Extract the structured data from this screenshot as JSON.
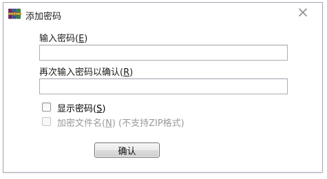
{
  "dialog": {
    "title": "添加密码",
    "icon": "winrar-books-icon",
    "close_icon": "close-icon"
  },
  "password": {
    "label_prefix": "输入密码(",
    "label_key": "E",
    "label_suffix": ")",
    "value": ""
  },
  "confirm_password": {
    "label_prefix": "再次输入密码以确认(",
    "label_key": "R",
    "label_suffix": ")",
    "value": ""
  },
  "show_password": {
    "label_prefix": "显示密码(",
    "label_key": "S",
    "label_suffix": ")",
    "checked": false
  },
  "encrypt_filenames": {
    "label_prefix": "加密文件名(",
    "label_key": "N",
    "label_suffix": ") (不支持ZIP格式)",
    "checked": false,
    "enabled": false
  },
  "buttons": {
    "ok_label": "确认"
  }
}
